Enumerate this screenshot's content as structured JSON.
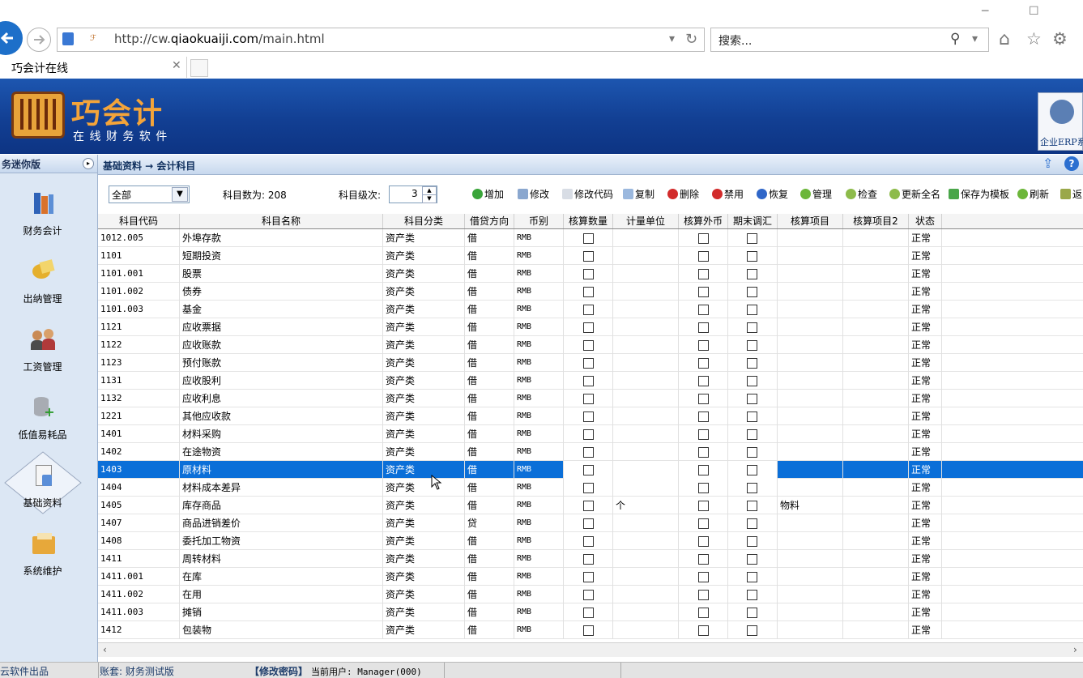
{
  "browser": {
    "url_prefix": "http://cw.",
    "url_domain": "qiaokuaiji.com",
    "url_suffix": "/main.html",
    "search_placeholder": "搜索...",
    "tab_title": "巧会计在线"
  },
  "header": {
    "brand": "巧会计",
    "tagline": "在 线 财 务 软 件",
    "erp_label": "企业ERP系"
  },
  "sidebar": {
    "title": "务迷你版",
    "items": [
      {
        "label": "财务会计"
      },
      {
        "label": "出纳管理"
      },
      {
        "label": "工资管理"
      },
      {
        "label": "低值易耗品"
      },
      {
        "label": "基础资料"
      },
      {
        "label": "系统维护"
      }
    ]
  },
  "breadcrumb": {
    "path": "基础资料 → 会计科目"
  },
  "filter": {
    "category_value": "全部",
    "count_label": "科目数为: 208",
    "level_label": "科目级次:",
    "level_value": "3"
  },
  "toolbar": {
    "add": "增加",
    "edit": "修改",
    "edit_code": "修改代码",
    "copy": "复制",
    "delete": "删除",
    "disable": "禁用",
    "restore": "恢复",
    "manage": "管理",
    "check": "检查",
    "update_fullname": "更新全名",
    "save_template": "保存为模板",
    "refresh": "刷新",
    "back": "返"
  },
  "grid": {
    "columns": [
      "科目代码",
      "科目名称",
      "科目分类",
      "借贷方向",
      "币别",
      "核算数量",
      "计量单位",
      "核算外币",
      "期末调汇",
      "核算项目",
      "核算项目2",
      "状态"
    ],
    "rows": [
      {
        "code": "1012.005",
        "name": "外埠存款",
        "cat": "资产类",
        "dir": "借",
        "cur": "RMB",
        "unit": "",
        "item": "",
        "status": "正常"
      },
      {
        "code": "1101",
        "name": "短期投资",
        "cat": "资产类",
        "dir": "借",
        "cur": "RMB",
        "unit": "",
        "item": "",
        "status": "正常"
      },
      {
        "code": "1101.001",
        "name": "股票",
        "cat": "资产类",
        "dir": "借",
        "cur": "RMB",
        "unit": "",
        "item": "",
        "status": "正常"
      },
      {
        "code": "1101.002",
        "name": "债券",
        "cat": "资产类",
        "dir": "借",
        "cur": "RMB",
        "unit": "",
        "item": "",
        "status": "正常"
      },
      {
        "code": "1101.003",
        "name": "基金",
        "cat": "资产类",
        "dir": "借",
        "cur": "RMB",
        "unit": "",
        "item": "",
        "status": "正常"
      },
      {
        "code": "1121",
        "name": "应收票据",
        "cat": "资产类",
        "dir": "借",
        "cur": "RMB",
        "unit": "",
        "item": "",
        "status": "正常"
      },
      {
        "code": "1122",
        "name": "应收账款",
        "cat": "资产类",
        "dir": "借",
        "cur": "RMB",
        "unit": "",
        "item": "",
        "status": "正常"
      },
      {
        "code": "1123",
        "name": "预付账款",
        "cat": "资产类",
        "dir": "借",
        "cur": "RMB",
        "unit": "",
        "item": "",
        "status": "正常"
      },
      {
        "code": "1131",
        "name": "应收股利",
        "cat": "资产类",
        "dir": "借",
        "cur": "RMB",
        "unit": "",
        "item": "",
        "status": "正常"
      },
      {
        "code": "1132",
        "name": "应收利息",
        "cat": "资产类",
        "dir": "借",
        "cur": "RMB",
        "unit": "",
        "item": "",
        "status": "正常"
      },
      {
        "code": "1221",
        "name": "其他应收款",
        "cat": "资产类",
        "dir": "借",
        "cur": "RMB",
        "unit": "",
        "item": "",
        "status": "正常"
      },
      {
        "code": "1401",
        "name": "材料采购",
        "cat": "资产类",
        "dir": "借",
        "cur": "RMB",
        "unit": "",
        "item": "",
        "status": "正常"
      },
      {
        "code": "1402",
        "name": "在途物资",
        "cat": "资产类",
        "dir": "借",
        "cur": "RMB",
        "unit": "",
        "item": "",
        "status": "正常"
      },
      {
        "code": "1403",
        "name": "原材料",
        "cat": "资产类",
        "dir": "借",
        "cur": "RMB",
        "unit": "",
        "item": "",
        "status": "正常",
        "selected": true
      },
      {
        "code": "1404",
        "name": "材料成本差异",
        "cat": "资产类",
        "dir": "借",
        "cur": "RMB",
        "unit": "",
        "item": "",
        "status": "正常"
      },
      {
        "code": "1405",
        "name": "库存商品",
        "cat": "资产类",
        "dir": "借",
        "cur": "RMB",
        "unit": "个",
        "item": "物料",
        "status": "正常"
      },
      {
        "code": "1407",
        "name": "商品进销差价",
        "cat": "资产类",
        "dir": "贷",
        "cur": "RMB",
        "unit": "",
        "item": "",
        "status": "正常"
      },
      {
        "code": "1408",
        "name": "委托加工物资",
        "cat": "资产类",
        "dir": "借",
        "cur": "RMB",
        "unit": "",
        "item": "",
        "status": "正常"
      },
      {
        "code": "1411",
        "name": "周转材料",
        "cat": "资产类",
        "dir": "借",
        "cur": "RMB",
        "unit": "",
        "item": "",
        "status": "正常"
      },
      {
        "code": "1411.001",
        "name": "在库",
        "cat": "资产类",
        "dir": "借",
        "cur": "RMB",
        "unit": "",
        "item": "",
        "status": "正常"
      },
      {
        "code": "1411.002",
        "name": "在用",
        "cat": "资产类",
        "dir": "借",
        "cur": "RMB",
        "unit": "",
        "item": "",
        "status": "正常"
      },
      {
        "code": "1411.003",
        "name": "摊销",
        "cat": "资产类",
        "dir": "借",
        "cur": "RMB",
        "unit": "",
        "item": "",
        "status": "正常"
      },
      {
        "code": "1412",
        "name": "包装物",
        "cat": "资产类",
        "dir": "借",
        "cur": "RMB",
        "unit": "",
        "item": "",
        "status": "正常"
      }
    ]
  },
  "status": {
    "left": "云软件出品",
    "account": "账套: 财务测试版",
    "change_pwd": "【修改密码】",
    "user": "当前用户: Manager(000)"
  },
  "colors": {
    "accent": "#0b6fd8",
    "header": "#123f93"
  }
}
